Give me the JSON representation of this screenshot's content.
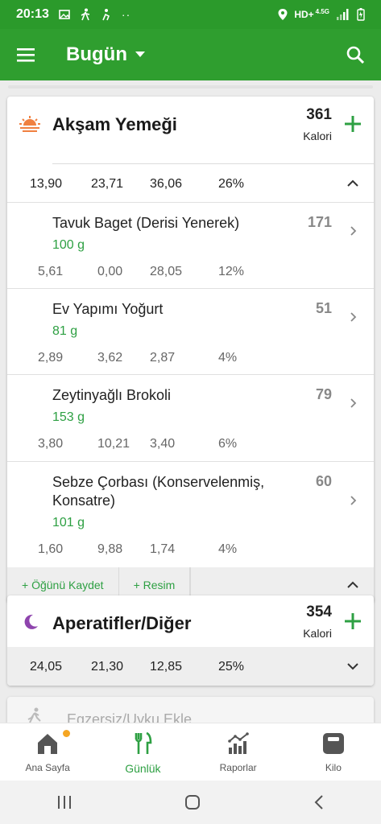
{
  "status_bar": {
    "time": "20:13",
    "network": "HD+",
    "network_sub": "4.5G"
  },
  "app_bar": {
    "title": "Bugün"
  },
  "colors": {
    "primary": "#2f9e2f",
    "accent_green": "#2ea043",
    "status_green": "#2b9a2b",
    "sunset_orange": "#f08040",
    "moon_purple": "#8e44ad",
    "badge_orange": "#f5a623"
  },
  "meals": [
    {
      "title": "Akşam Yemeği",
      "icon": "sunset-icon",
      "calories": "361",
      "calories_label": "Kalori",
      "summary": [
        "13,90",
        "23,71",
        "36,06",
        "26%"
      ],
      "foods": [
        {
          "name": "Tavuk Baget (Derisi Yenerek)",
          "calories": "171",
          "amount": "100  g",
          "values": [
            "5,61",
            "0,00",
            "28,05",
            "12%"
          ]
        },
        {
          "name": "Ev Yapımı Yoğurt",
          "calories": "51",
          "amount": "81  g",
          "values": [
            "2,89",
            "3,62",
            "2,87",
            "4%"
          ]
        },
        {
          "name": "Zeytinyağlı Brokoli",
          "calories": "79",
          "amount": "153  g",
          "values": [
            "3,80",
            "10,21",
            "3,40",
            "6%"
          ]
        },
        {
          "name": "Sebze Çorbası (Konservelenmiş, Konsatre)",
          "calories": "60",
          "amount": "101  g",
          "values": [
            "1,60",
            "9,88",
            "1,74",
            "4%"
          ]
        }
      ],
      "actions": [
        "+ Öğünü Kaydet",
        "+ Resim"
      ]
    },
    {
      "title": "Aperatifler/Diğer",
      "icon": "moon-icon",
      "calories": "354",
      "calories_label": "Kalori",
      "summary": [
        "24,05",
        "21,30",
        "12,85",
        "25%"
      ]
    }
  ],
  "peek": {
    "label": "Egzersiz/Uyku Ekle"
  },
  "bottom_nav": [
    {
      "label": "Ana Sayfa",
      "icon": "home-icon"
    },
    {
      "label": "Günlük",
      "icon": "fork-knife-icon"
    },
    {
      "label": "Raporlar",
      "icon": "reports-icon"
    },
    {
      "label": "Kilo",
      "icon": "scale-icon"
    }
  ]
}
